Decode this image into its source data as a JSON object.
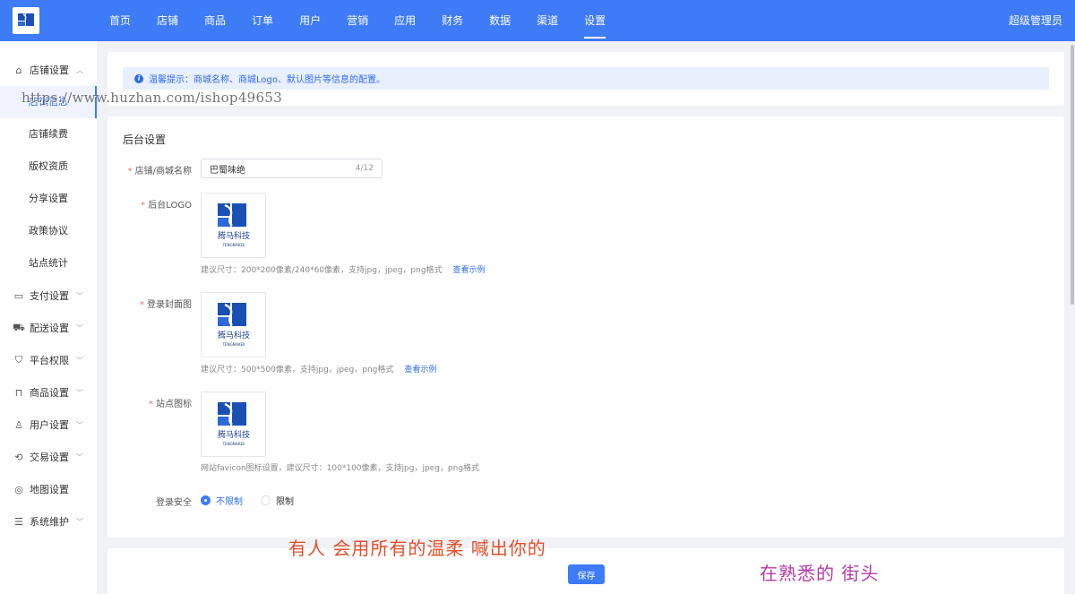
{
  "colors": {
    "primary": "#3d7bf7",
    "required": "#f56c6c",
    "link": "#2d6cf0"
  },
  "header": {
    "nav": [
      "首页",
      "店铺",
      "商品",
      "订单",
      "用户",
      "营销",
      "应用",
      "财务",
      "数据",
      "渠道",
      "设置"
    ],
    "active": "设置",
    "admin": "超级管理员"
  },
  "sidebar": {
    "groups": [
      {
        "icon": "home-icon",
        "label": "店铺设置",
        "expanded": true,
        "items": [
          "店铺信息",
          "店铺续费",
          "版权资质",
          "分享设置",
          "政策协议",
          "站点统计"
        ],
        "active_item": "店铺信息"
      },
      {
        "icon": "payment-icon",
        "label": "支付设置"
      },
      {
        "icon": "truck-icon",
        "label": "配送设置"
      },
      {
        "icon": "shield-icon",
        "label": "平台权限"
      },
      {
        "icon": "bag-icon",
        "label": "商品设置"
      },
      {
        "icon": "user-icon",
        "label": "用户设置"
      },
      {
        "icon": "exchange-icon",
        "label": "交易设置"
      },
      {
        "icon": "map-icon",
        "label": "地图设置"
      },
      {
        "icon": "sliders-icon",
        "label": "系统维护"
      }
    ]
  },
  "notice": {
    "text": "温馨提示：商城名称、商城Logo、默认图片等信息的配置。"
  },
  "form": {
    "section_title": "后台设置",
    "store_name": {
      "label": "店铺/商城名称",
      "value": "巴蜀味绝",
      "count": "4/12"
    },
    "logo": {
      "label": "后台LOGO",
      "hint": "建议尺寸：200*200像素/240*60像素，支持jpg，jpeg，png格式",
      "link": "查看示例"
    },
    "cover": {
      "label": "登录封面图",
      "hint": "建议尺寸：500*500像素，支持jpg，jpeg，png格式",
      "link": "查看示例"
    },
    "favicon": {
      "label": "站点图标",
      "hint": "网站favicon图标设置，建议尺寸：100*100像素，支持jpg，jpeg，png格式"
    },
    "login_security": {
      "label": "登录安全",
      "options": [
        "不限制",
        "限制"
      ],
      "selected": "不限制"
    }
  },
  "brand_image_text": {
    "cn": "腾马科技",
    "en": "TENGMAKEII"
  },
  "save_label": "保存",
  "overlays": {
    "watermark": "https://www.huzhan.com/ishop49653",
    "lyric1": "有人 会用所有的温柔 喊出你的",
    "lyric2": "在熟悉的 街头"
  }
}
